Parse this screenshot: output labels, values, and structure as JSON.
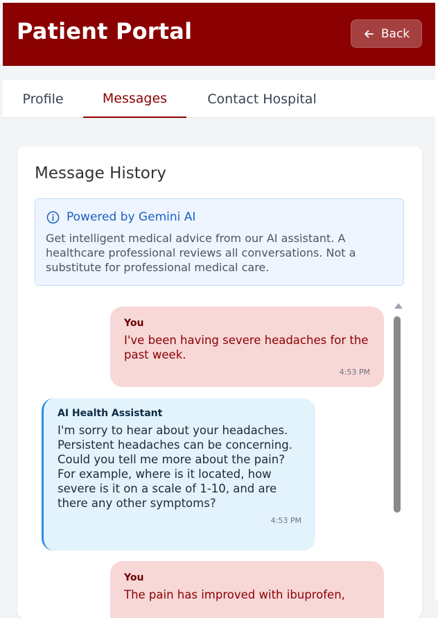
{
  "header": {
    "title": "Patient Portal",
    "back_label": "Back",
    "background": "#8b0000"
  },
  "tabs": [
    {
      "label": "Profile",
      "active": false
    },
    {
      "label": "Messages",
      "active": true
    },
    {
      "label": "Contact Hospital",
      "active": false
    }
  ],
  "messages_card": {
    "title": "Message History",
    "info": {
      "icon": "info-icon",
      "title": "Powered by Gemini AI",
      "text": "Get intelligent medical advice from our AI assistant. A healthcare professional reviews all conversations. Not a substitute for professional medical care."
    },
    "messages": [
      {
        "sender": "You",
        "text": "I've been having severe headaches for the past week.",
        "time": "4:53 PM"
      },
      {
        "sender": "AI Health Assistant",
        "text": "I'm sorry to hear about your headaches. Persistent headaches can be concerning. Could you tell me more about the pain? For example, where is it located, how severe is it on a scale of 1-10, and are there any other symptoms?",
        "time": "4:53 PM"
      },
      {
        "sender": "You",
        "text": "The pain has improved with ibuprofen,",
        "time": ""
      }
    ]
  },
  "colors": {
    "accent": "#8b0000",
    "user_bubble": "#f8d7d7",
    "ai_bubble": "#e3f3fc",
    "info_blue": "#1d5fc4"
  }
}
